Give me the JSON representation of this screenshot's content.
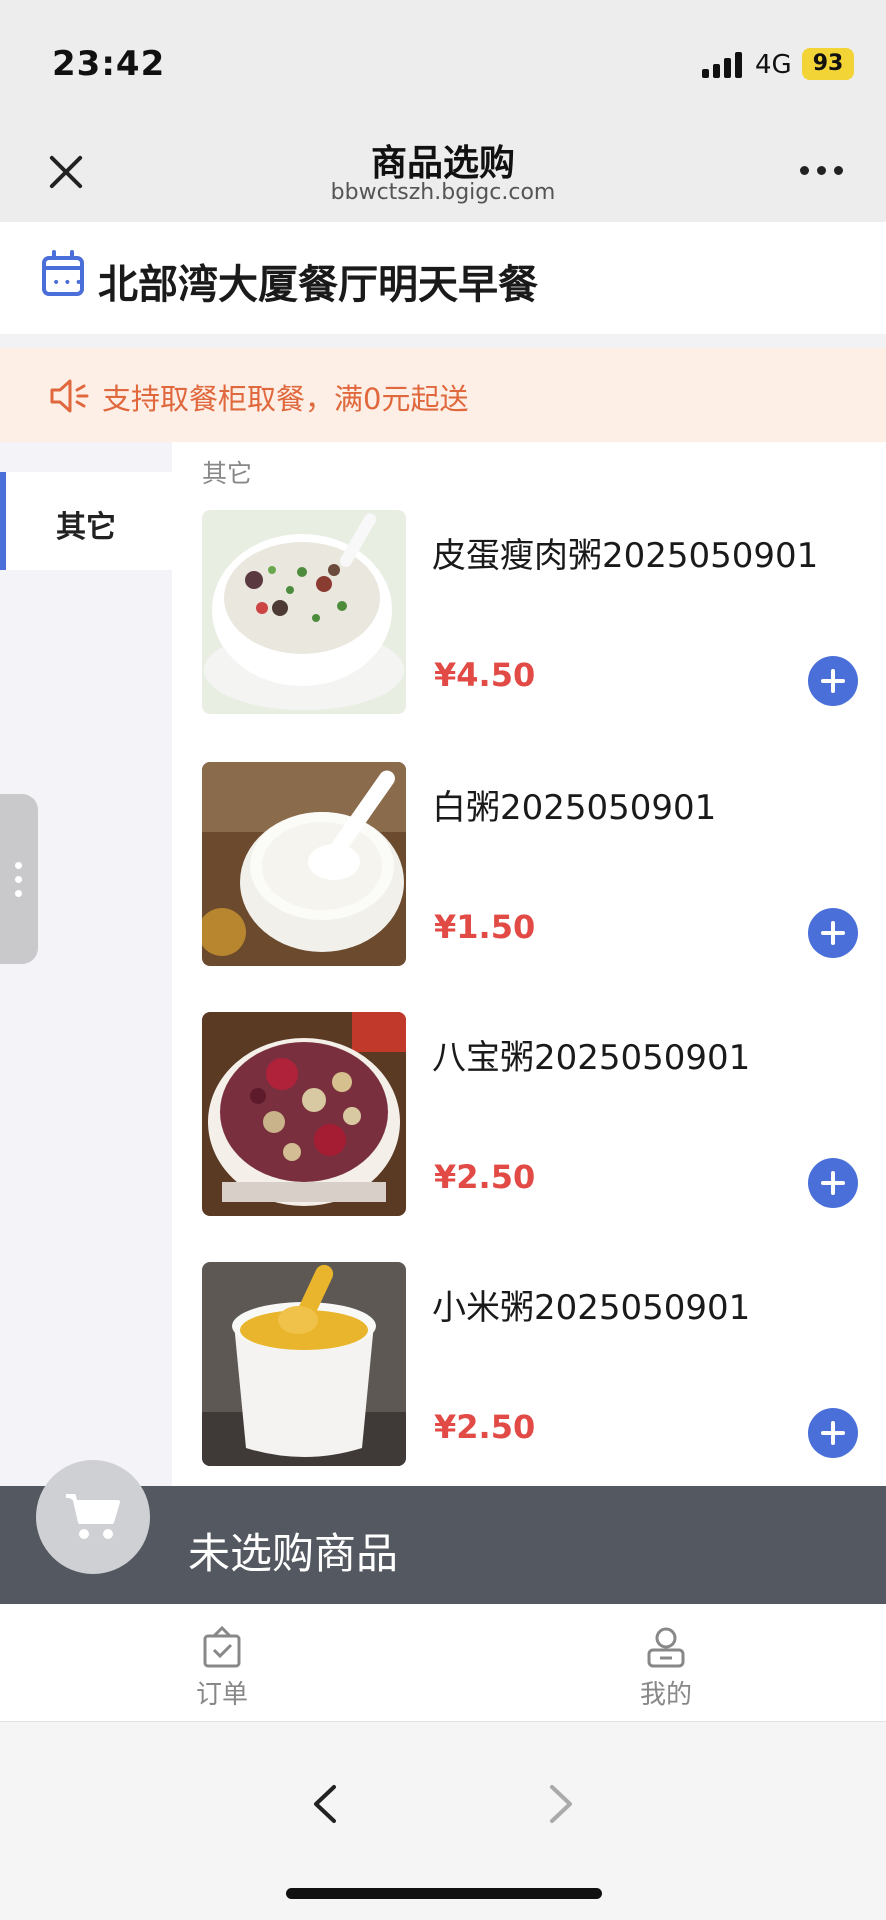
{
  "status_bar": {
    "time": "23:42",
    "network": "4G",
    "battery": "93"
  },
  "nav": {
    "title": "商品选购",
    "subtitle": "bbwctszh.bgigc.com"
  },
  "restaurant": {
    "title": "北部湾大厦餐厅明天早餐"
  },
  "notice": {
    "text": "支持取餐柜取餐，满0元起送"
  },
  "sidebar": {
    "categories": [
      {
        "label": "其它",
        "selected": true
      }
    ]
  },
  "section": {
    "heading": "其它"
  },
  "products": [
    {
      "name": "皮蛋瘦肉粥2025050901",
      "price": "¥4.50",
      "image": "century-egg-pork-congee"
    },
    {
      "name": "白粥2025050901",
      "price": "¥1.50",
      "image": "plain-congee"
    },
    {
      "name": "八宝粥2025050901",
      "price": "¥2.50",
      "image": "eight-treasure-congee"
    },
    {
      "name": "小米粥2025050901",
      "price": "¥2.50",
      "image": "millet-congee"
    }
  ],
  "cart": {
    "label": "未选购商品"
  },
  "tabs": [
    {
      "label": "订单",
      "icon": "order-bag-icon"
    },
    {
      "label": "我的",
      "icon": "profile-icon"
    }
  ],
  "colors": {
    "accent": "#4a6fd8",
    "price": "#e14a45",
    "notice_text": "#e0683d",
    "notice_bg": "#fdeee6",
    "cart_bar": "#545961"
  }
}
